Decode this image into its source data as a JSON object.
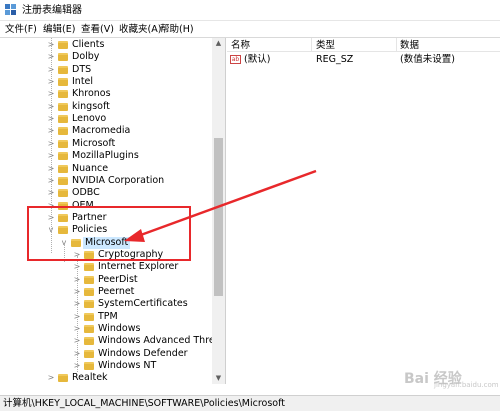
{
  "window": {
    "title": "注册表编辑器"
  },
  "menu": {
    "file": "文件(F)",
    "edit": "编辑(E)",
    "view": "查看(V)",
    "favorites": "收藏夹(A)",
    "help": "帮助(H)"
  },
  "tree": {
    "items": [
      {
        "label": "Clients",
        "expander": ">"
      },
      {
        "label": "Dolby",
        "expander": ">"
      },
      {
        "label": "DTS",
        "expander": ">"
      },
      {
        "label": "Intel",
        "expander": ">"
      },
      {
        "label": "Khronos",
        "expander": ">"
      },
      {
        "label": "kingsoft",
        "expander": ">"
      },
      {
        "label": "Lenovo",
        "expander": ">"
      },
      {
        "label": "Macromedia",
        "expander": ">"
      },
      {
        "label": "Microsoft",
        "expander": ">"
      },
      {
        "label": "MozillaPlugins",
        "expander": ">"
      },
      {
        "label": "Nuance",
        "expander": ">"
      },
      {
        "label": "NVIDIA Corporation",
        "expander": ">"
      },
      {
        "label": "ODBC",
        "expander": ">"
      },
      {
        "label": "OEM",
        "expander": ">"
      },
      {
        "label": "Partner",
        "expander": ">"
      },
      {
        "label": "Policies",
        "expander": "v"
      },
      {
        "label": "Microsoft",
        "expander": "v"
      },
      {
        "label": "Cryptography",
        "expander": ">"
      },
      {
        "label": "Internet Explorer",
        "expander": ">"
      },
      {
        "label": "PeerDist",
        "expander": ">"
      },
      {
        "label": "Peernet",
        "expander": ">"
      },
      {
        "label": "SystemCertificates",
        "expander": ">"
      },
      {
        "label": "TPM",
        "expander": ">"
      },
      {
        "label": "Windows",
        "expander": ">"
      },
      {
        "label": "Windows Advanced Threat P",
        "expander": ">"
      },
      {
        "label": "Windows Defender",
        "expander": ">"
      },
      {
        "label": "Windows NT",
        "expander": ">"
      },
      {
        "label": "Realtek",
        "expander": ">"
      }
    ]
  },
  "values": {
    "headers": {
      "name": "名称",
      "type": "类型",
      "data": "数据"
    },
    "rows": [
      {
        "name": "(默认)",
        "type": "REG_SZ",
        "data": "(数值未设置)",
        "icon_text": "ab"
      }
    ]
  },
  "status": {
    "path": "计算机\\HKEY_LOCAL_MACHINE\\SOFTWARE\\Policies\\Microsoft"
  },
  "watermark": {
    "text": "Bai 经验",
    "sub": "jingyan.baidu.com"
  },
  "colors": {
    "highlight": "#e8282b",
    "selection": "#cce8ff",
    "folder": "#e6b83c"
  }
}
